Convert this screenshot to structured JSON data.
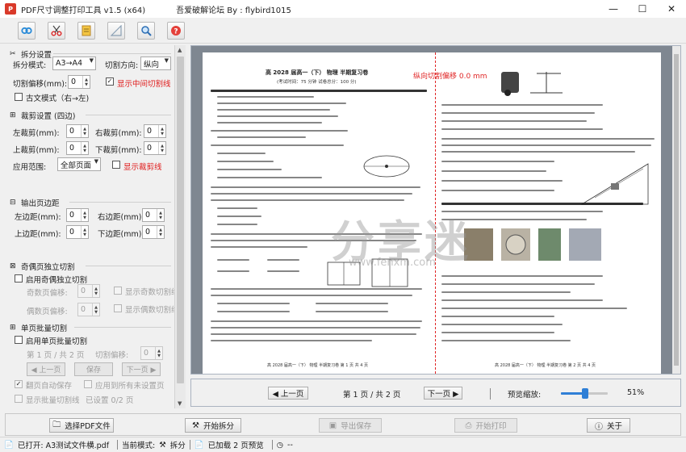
{
  "window": {
    "title": "PDF尺寸调整打印工具 v1.5   (x64)",
    "credit": "吾爱破解论坛  By : flybird1015",
    "minimize": "—",
    "maximize": "☐",
    "close": "✕"
  },
  "toolbar": {
    "icons": [
      "link-icon",
      "scissors-icon",
      "notes-icon",
      "ruler-icon",
      "zoom-icon",
      "help-icon"
    ]
  },
  "split": {
    "section_title": "拆分设置",
    "mode_label": "拆分模式:",
    "mode_value": "A3→A4",
    "direction_label": "切割方向:",
    "direction_value": "纵向",
    "offset_label": "切割偏移(mm):",
    "offset_value": "0",
    "show_cutline_label": "显示中间切割线",
    "show_cutline_checked": true,
    "ancient_mode_label": "古文模式（右→左)",
    "ancient_mode_checked": false
  },
  "crop": {
    "section_title": "裁剪设置 (四边)",
    "left_label": "左裁剪(mm):",
    "left_value": "0",
    "right_label": "右裁剪(mm):",
    "right_value": "0",
    "top_label": "上裁剪(mm):",
    "top_value": "0",
    "bottom_label": "下裁剪(mm):",
    "bottom_value": "0",
    "scope_label": "应用范围:",
    "scope_value": "全部页面",
    "show_crop_label": "显示裁剪线",
    "show_crop_checked": false
  },
  "margins": {
    "section_title": "输出页边距",
    "left_label": "左边距(mm):",
    "left_value": "0",
    "right_label": "右边距(mm):",
    "right_value": "0",
    "top_label": "上边距(mm):",
    "top_value": "0",
    "bottom_label": "下边距(mm):",
    "bottom_value": "0"
  },
  "oddeven": {
    "section_title": "奇偶页独立切割",
    "enable_label": "启用奇偶独立切割",
    "odd_label": "奇数页偏移:",
    "odd_value": "0",
    "show_odd_label": "显示奇数切割线",
    "even_label": "偶数页偏移:",
    "even_value": "0",
    "show_even_label": "显示偶数切割线"
  },
  "batch": {
    "section_title": "单页批量切割",
    "enable_label": "启用单页批量切割",
    "page_info": "第 1 页 / 共 2 页",
    "cut_offset_label": "切割偏移:",
    "cut_offset_value": "0",
    "prev_label": "◀ 上一页",
    "save_label": "保存",
    "next_label": "下一页 ▶",
    "autosave_label": "翻页自动保存",
    "autosave_checked": true,
    "apply_all_label": "应用到所有未设置页",
    "show_batch_label": "显示批量切割线",
    "saved_info": "已设置 0/2 页"
  },
  "preview": {
    "offset_indicator": "纵向切割偏移  0.0 mm",
    "watermark": "分享迷",
    "watermark_url": "www.fenxm.com",
    "left_page": {
      "title": "高 2028 届高一（下）  物理  半期复习卷",
      "subtitle": "(考试时间：75 分钟      试卷总分：100 分)",
      "footer": "高 2028 届高一（下）  物理  半期复习卷  第 1 页  共 4 页"
    },
    "right_page": {
      "footer": "高 2028 届高一（下）  物理  半期复习卷  第 2 页  共 4 页"
    }
  },
  "nav": {
    "prev_label": "◀ 上一页",
    "page_info": "第 1 页 / 共 2 页",
    "next_label": "下一页 ▶",
    "zoom_label": "预览缩放:",
    "zoom_value": "51%",
    "zoom_fraction": 0.51
  },
  "actions": {
    "select_pdf": "选择PDF文件",
    "start_split": "开始拆分",
    "export_save": "导出保存",
    "start_print": "开始打印",
    "about": "关于"
  },
  "status": {
    "file": "已打开: A3测试文件横.pdf",
    "mode_prefix": "当前模式:",
    "mode_value": "拆分",
    "loaded": "已加载 2 页预览",
    "timer": "--"
  }
}
